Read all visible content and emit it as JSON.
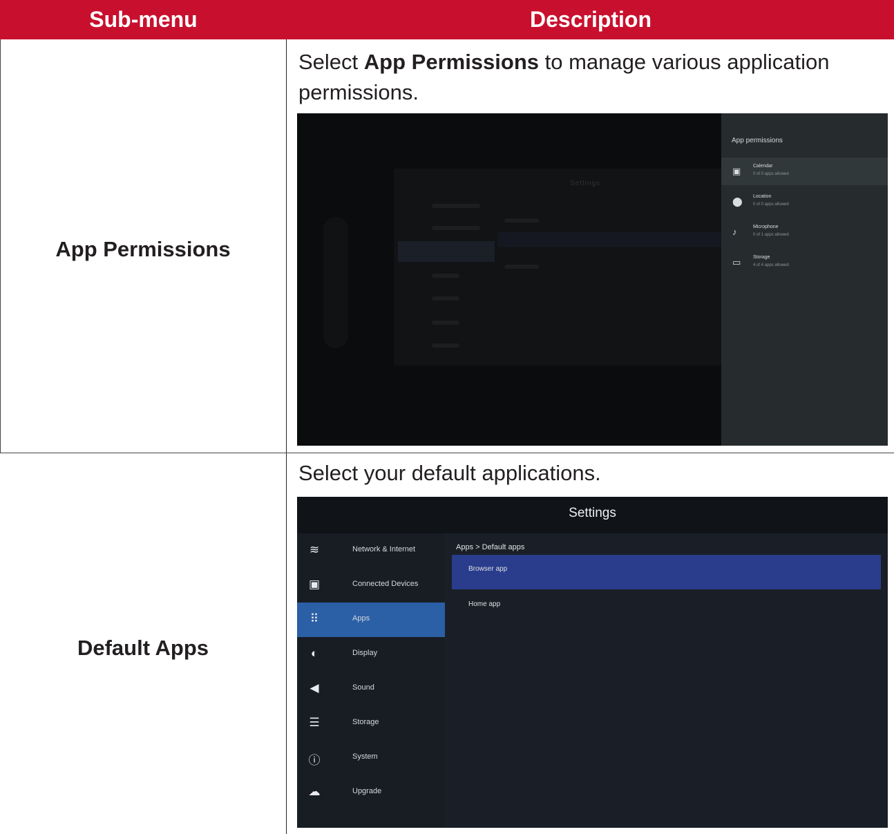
{
  "table": {
    "header": {
      "col1": "Sub-menu",
      "col2": "Description"
    },
    "rows": [
      {
        "label": "App Permissions",
        "desc_before": "Select ",
        "desc_bold": "App Permissions",
        "desc_after": " to manage various application permissions."
      },
      {
        "label": "Default Apps",
        "desc": "Select your default applications."
      }
    ]
  },
  "screenshot1": {
    "dimmed_title": "Settings",
    "panel_title": "App permissions",
    "items": [
      {
        "name": "Calendar",
        "sub": "0 of 0 apps allowed",
        "icon": "calendar-icon",
        "glyph": "▣"
      },
      {
        "name": "Location",
        "sub": "0 of 0 apps allowed",
        "icon": "location-pin-icon",
        "glyph": "⬤"
      },
      {
        "name": "Microphone",
        "sub": "0 of 1 apps allowed",
        "icon": "microphone-icon",
        "glyph": "♪"
      },
      {
        "name": "Storage",
        "sub": "4 of 4 apps allowed",
        "icon": "folder-icon",
        "glyph": "▭"
      }
    ]
  },
  "screenshot2": {
    "title": "Settings",
    "breadcrumb": "Apps > Default apps",
    "sidebar": [
      {
        "label": "Network & Internet",
        "icon": "wifi-icon",
        "glyph": "≋"
      },
      {
        "label": "Connected Devices",
        "icon": "connected-devices-icon",
        "glyph": "▣"
      },
      {
        "label": "Apps",
        "icon": "apps-grid-icon",
        "glyph": "⠿"
      },
      {
        "label": "Display",
        "icon": "display-brightness-icon",
        "glyph": "◐"
      },
      {
        "label": "Sound",
        "icon": "speaker-icon",
        "glyph": "◀"
      },
      {
        "label": "Storage",
        "icon": "storage-icon",
        "glyph": "☰"
      },
      {
        "label": "System",
        "icon": "info-icon",
        "glyph": "ⓘ"
      },
      {
        "label": "Upgrade",
        "icon": "cloud-upload-icon",
        "glyph": "☁"
      }
    ],
    "options": [
      "Browser app",
      "Home app"
    ],
    "colors": {
      "active": "#2b5fa6",
      "selected": "#2a3d8c",
      "header": "#c8102e"
    }
  }
}
